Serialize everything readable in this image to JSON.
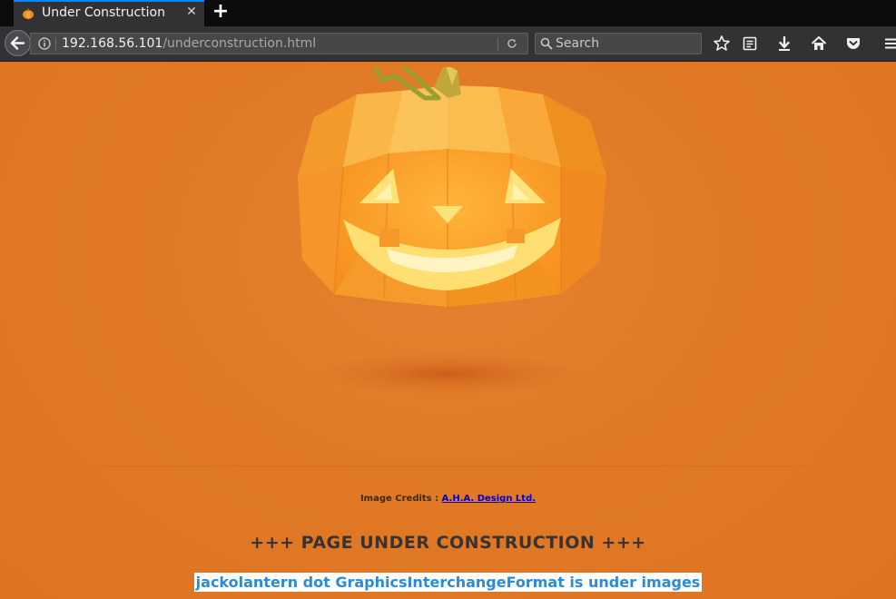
{
  "browser": {
    "tab": {
      "title": "Under Construction",
      "favicon": "pumpkin-favicon"
    },
    "new_tab_label": "+",
    "address": {
      "host": "192.168.56.101",
      "path": "/underconstruction.html"
    },
    "search": {
      "placeholder": "Search"
    },
    "toolbar_icons": [
      "star-icon",
      "reading-list-icon",
      "download-icon",
      "home-icon",
      "pocket-icon",
      "menu-icon"
    ],
    "accent": "#0a84ff"
  },
  "page": {
    "background": "#e07723",
    "image_alt": "jack-o-lantern pumpkin",
    "credits": {
      "label": "Image Credits : ",
      "link_text": "A.H.A. Design Ltd."
    },
    "headline": "+++ PAGE UNDER CONSTRUCTION +++",
    "hint": "jackolantern dot GraphicsInterchangeFormat is under images"
  }
}
